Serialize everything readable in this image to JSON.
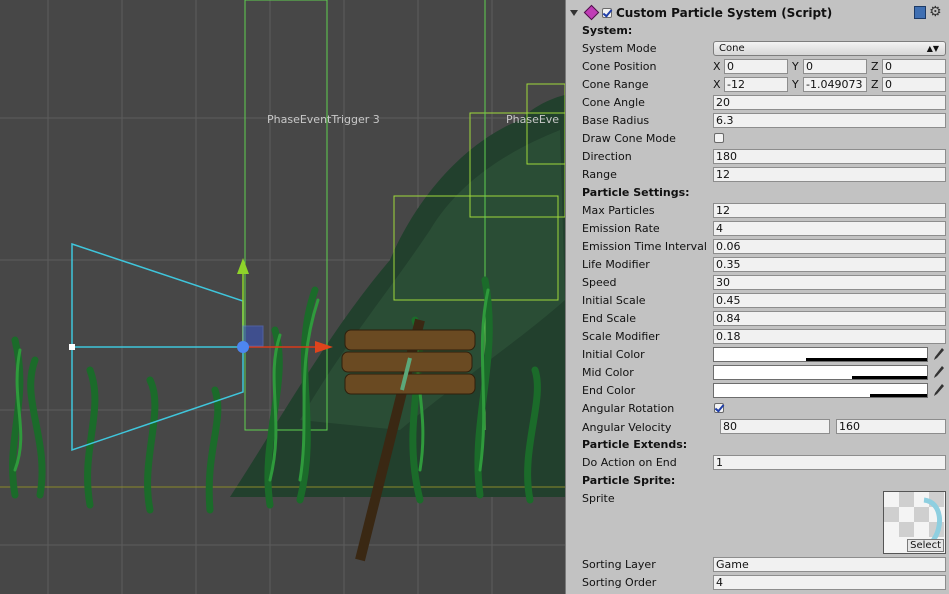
{
  "scene": {
    "labels": [
      "PhaseEventTrigger 3",
      "PhaseEve"
    ]
  },
  "inspector": {
    "component_title": "Custom Particle System (Script)",
    "icons": {
      "fold": "foldout-arrow-icon",
      "component": "script-gem-icon",
      "help": "help-book-icon",
      "settings": "gear-icon",
      "eyedropper": "eyedropper-icon"
    },
    "sections": {
      "system": "System:",
      "particle_settings": "Particle Settings:",
      "particle_extends": "Particle Extends:",
      "particle_sprite": "Particle Sprite:"
    },
    "system": {
      "mode_label": "System Mode",
      "mode_value": "Cone",
      "cone_position_label": "Cone Position",
      "cone_position": {
        "x": "0",
        "y": "0",
        "z": "0"
      },
      "cone_range_label": "Cone Range",
      "cone_range": {
        "x": "-12",
        "y": "-1.049073",
        "z": "0"
      },
      "cone_angle_label": "Cone Angle",
      "cone_angle": "20",
      "base_radius_label": "Base Radius",
      "base_radius": "6.3",
      "draw_cone_mode_label": "Draw Cone Mode",
      "draw_cone_mode_checked": false,
      "direction_label": "Direction",
      "direction": "180",
      "range_label": "Range",
      "range": "12"
    },
    "axis_labels": {
      "x": "X",
      "y": "Y",
      "z": "Z"
    },
    "particle_settings": {
      "max_particles_label": "Max Particles",
      "max_particles": "12",
      "emission_rate_label": "Emission Rate",
      "emission_rate": "4",
      "emission_time_interval_label": "Emission Time Interval",
      "emission_time_interval": "0.06",
      "life_modifier_label": "Life Modifier",
      "life_modifier": "0.35",
      "speed_label": "Speed",
      "speed": "30",
      "initial_scale_label": "Initial Scale",
      "initial_scale": "0.45",
      "end_scale_label": "End Scale",
      "end_scale": "0.84",
      "scale_modifier_label": "Scale Modifier",
      "scale_modifier": "0.18",
      "initial_color_label": "Initial Color",
      "mid_color_label": "Mid Color",
      "end_color_label": "End Color",
      "color_value": "#ffffff",
      "initial_color_alpha": 0.57,
      "mid_color_alpha": 0.35,
      "end_color_alpha": 0.27,
      "angular_rotation_label": "Angular Rotation",
      "angular_rotation_checked": true,
      "angular_velocity_label": "Angular Velocity",
      "angular_velocity": {
        "min": "80",
        "max": "160"
      }
    },
    "particle_extends": {
      "do_action_on_end_label": "Do Action on End",
      "do_action_on_end": "1"
    },
    "particle_sprite": {
      "sprite_label": "Sprite",
      "select_label": "Select",
      "sorting_layer_label": "Sorting Layer",
      "sorting_layer": "Game",
      "sorting_order_label": "Sorting Order",
      "sorting_order": "4"
    }
  }
}
